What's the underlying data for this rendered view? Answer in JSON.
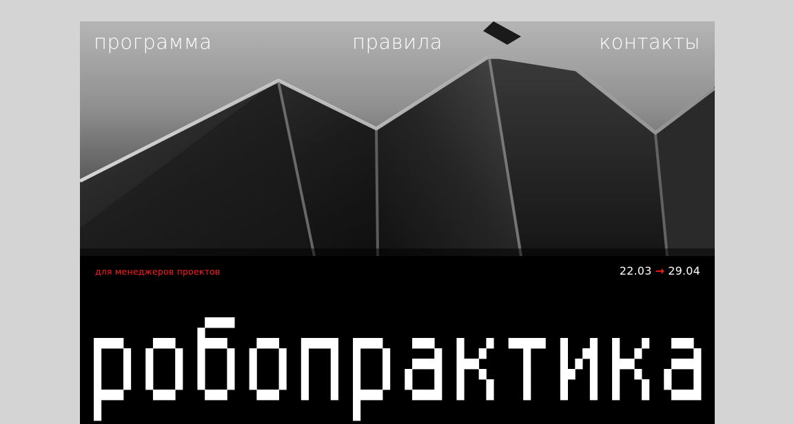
{
  "nav": {
    "program": "программа",
    "rules": "правила",
    "contacts": "контакты"
  },
  "hero": {
    "subtitle": "для менеджеров проектов",
    "date_start": "22.03",
    "date_arrow": "→",
    "date_end": "29.04",
    "wordmark": "робопрактика"
  },
  "colors": {
    "accent": "#ff1a1a",
    "background": "#000000",
    "page": "#d4d4d4",
    "text": "#ffffff"
  }
}
